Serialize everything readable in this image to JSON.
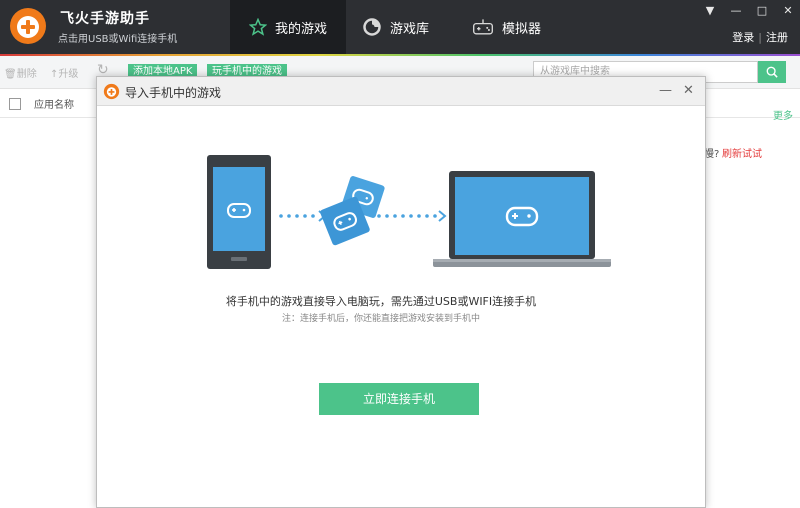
{
  "app": {
    "title": "飞火手游助手",
    "subtitle": "点击用USB或Wifi连接手机"
  },
  "nav": {
    "tabs": [
      {
        "label": "我的游戏",
        "icon": "star-icon",
        "active": true
      },
      {
        "label": "游戏库",
        "icon": "game-library-icon",
        "active": false
      },
      {
        "label": "模拟器",
        "icon": "gamepad-icon",
        "active": false
      }
    ]
  },
  "auth": {
    "login": "登录",
    "separator": "|",
    "register": "注册"
  },
  "toolbar": {
    "delete_label": "删除",
    "upgrade_label": "升级",
    "add_apk_label": "添加本地APK",
    "phone_games_label": "玩手机中的游戏",
    "search_placeholder": "从游戏库中搜索"
  },
  "list": {
    "column_name": "应用名称",
    "more_link": "更多",
    "slow_text": "慢?",
    "refresh_link": "刷新试试"
  },
  "dialog": {
    "title": "导入手机中的游戏",
    "main_text": "将手机中的游戏直接导入电脑玩，需先通过USB或WIFI连接手机",
    "note_text": "注：连接手机后，你还能直接把游戏安装到手机中",
    "connect_button": "立即连接手机"
  },
  "colors": {
    "titlebar": "#2d2f33",
    "accent_green": "#4cc38a",
    "illustration_blue": "#4aa3df",
    "device_dark": "#3a3f44",
    "logo_orange": "#f07a1a"
  }
}
